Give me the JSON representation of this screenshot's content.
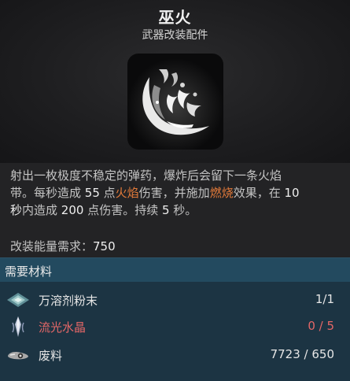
{
  "item": {
    "title": "巫火",
    "subtitle": "武器改装配件",
    "icon": "witchfire-ember-icon"
  },
  "description": {
    "line1": "射出一枚极度不稳定的弹药，爆炸后会留下一条火焰",
    "line2_a": "带。每秒造成 ",
    "line2_num": "55",
    "line2_b": " 点",
    "line2_fire": "火焰",
    "line2_c": "伤害，并施加",
    "line2_burn": "燃烧",
    "line2_d": "效果，在 ",
    "line2_num2": "10",
    "line3_a": "秒",
    "line3_b": "内造成 ",
    "line3_num": "200",
    "line3_c": " 点伤害。持续 ",
    "line3_num2": "5",
    "line3_d": " 秒。",
    "highlight_color": "#e27a3a"
  },
  "energy": {
    "label": "改装能量需求：",
    "value": "750"
  },
  "materials": {
    "title": "需要材料",
    "items": [
      {
        "name": "万溶剂粉末",
        "count": "1/1",
        "icon": "solvent-powder-icon",
        "sufficient": true
      },
      {
        "name": "流光水晶",
        "count": "0 / 5",
        "icon": "streaming-crystal-icon",
        "sufficient": false
      },
      {
        "name": "废料",
        "count": "7723 / 650",
        "icon": "scrap-icon",
        "sufficient": true
      }
    ],
    "shortage_color": "#e46767"
  }
}
